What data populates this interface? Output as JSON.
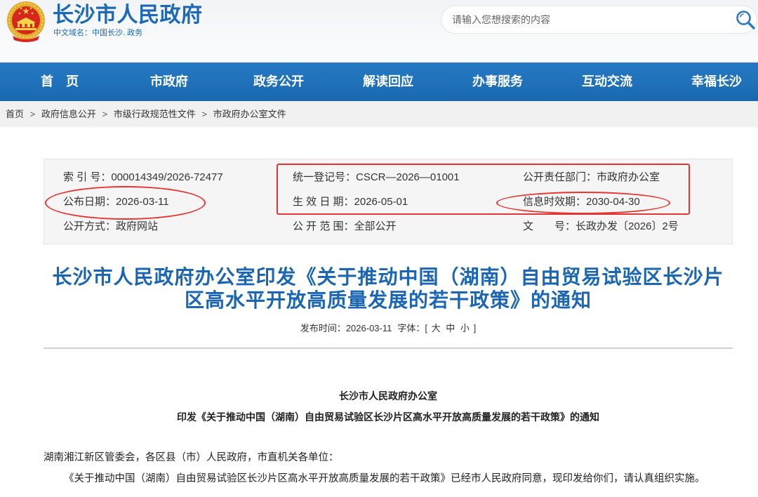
{
  "header": {
    "site_title": "长沙市人民政府",
    "domain_name": "中文域名：中国长沙. 政务",
    "emblem_icon": "national-emblem-icon",
    "search": {
      "placeholder": "请输入您想搜索的内容",
      "value": "",
      "icon": "search-icon"
    }
  },
  "nav": {
    "items": [
      {
        "label": "首　页"
      },
      {
        "label": "市政府"
      },
      {
        "label": "政务公开"
      },
      {
        "label": "解读回应"
      },
      {
        "label": "办事服务"
      },
      {
        "label": "互动交流"
      },
      {
        "label": "幸福长沙"
      }
    ]
  },
  "breadcrumb": {
    "items": [
      "首页",
      "政府信息公开",
      "市级行政规范性文件",
      "市政府办公室文件"
    ],
    "separator": ">"
  },
  "info_box": {
    "rows": [
      [
        {
          "label": "索 引 号：",
          "value": "000014349/2026-72477"
        },
        {
          "label": "统一登记号：",
          "value": "CSCR—2026—01001"
        },
        {
          "label": "公开责任部门：",
          "value": "市政府办公室"
        }
      ],
      [
        {
          "label": "公布日期：",
          "value": "2026-03-11"
        },
        {
          "label": "生 效 日 期：",
          "value": "2026-05-01"
        },
        {
          "label": "信息时效期：",
          "value": "2030-04-30"
        }
      ],
      [
        {
          "label": "公开方式：",
          "value": "政府网站"
        },
        {
          "label": "公 开 范 围：",
          "value": "全部公开"
        },
        {
          "label": "文　　号：",
          "value": "长政办发〔2026〕2号"
        }
      ]
    ]
  },
  "article": {
    "title_lines": [
      "长沙市人民政府办公室印发《关于推动中国（湖南）自由贸易试验区长沙片",
      "区高水平开放高质量发展的若干政策》的通知"
    ],
    "meta": {
      "publish_label": "发布时间：",
      "publish_date": "2026-03-11",
      "font_label": "字体：",
      "bracket_open": "[",
      "font_sizes": [
        "大",
        "中",
        "小"
      ],
      "bracket_close": "]"
    },
    "doc_issuer": "长沙市人民政府办公室",
    "doc_title": "印发《关于推动中国（湖南）自由贸易试验区长沙片区高水平开放高质量发展的若干政策》的通知",
    "salutation": "湖南湘江新区管委会，各区县（市）人民政府，市直机关各单位：",
    "paragraphs": [
      "《关于推动中国（湖南）自由贸易试验区长沙片区高水平开放高质量发展的若干政策》已经市人民政府同意，现印发给你们，请认真组织实施。"
    ]
  },
  "colors": {
    "brand_blue": "#1c69b7",
    "nav_blue": "#1a69af",
    "title_blue": "#1a66b2",
    "annotation_red": "#e5352f"
  }
}
